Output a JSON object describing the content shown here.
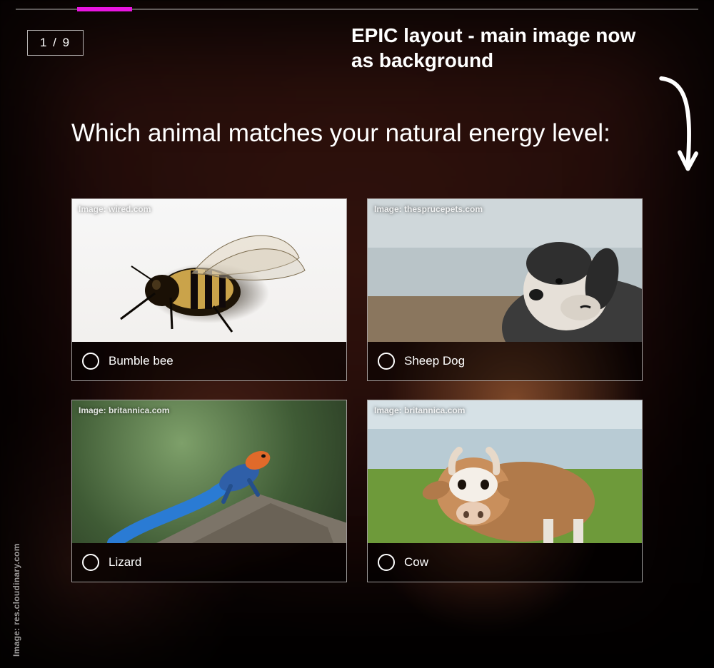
{
  "progress": {
    "page": "1 / 9",
    "percent": 11
  },
  "annotation": "EPIC layout - main image now as background",
  "question": "Which animal matches your natural energy level:",
  "background_credit": "Image: res.cloudinary.com",
  "options": [
    {
      "label": "Bumble bee",
      "credit": "Image: wired.com"
    },
    {
      "label": "Sheep Dog",
      "credit": "Image: thesprucepets.com"
    },
    {
      "label": "Lizard",
      "credit": "Image: britannica.com"
    },
    {
      "label": "Cow",
      "credit": "Image: britannica.com"
    }
  ]
}
